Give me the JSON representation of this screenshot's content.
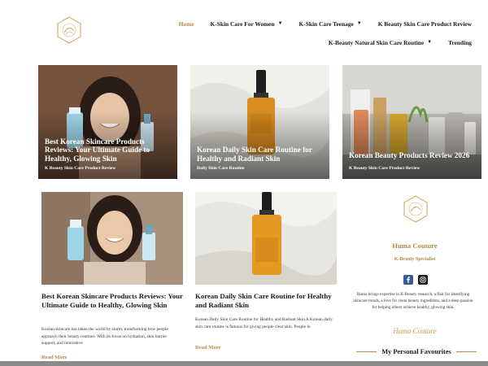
{
  "nav": {
    "row1": [
      {
        "label": "Home",
        "active": true,
        "dropdown": false
      },
      {
        "label": "K-Skin Care For Women",
        "active": false,
        "dropdown": true
      },
      {
        "label": "K-Skin Care Teenage",
        "active": false,
        "dropdown": true
      },
      {
        "label": "K Beauty Skin Care Product Review",
        "active": false,
        "dropdown": false
      }
    ],
    "row2": [
      {
        "label": "K-Beauty Natural Skin Care Routine",
        "active": false,
        "dropdown": true
      },
      {
        "label": "Trending",
        "active": false,
        "dropdown": false
      }
    ],
    "caret": "▼"
  },
  "hero": [
    {
      "title": "Best Korean Skincare Products Reviews: Your Ultimate Guide to Healthy, Glowing Skin",
      "category": "K Beauty Skin Care Product Review"
    },
    {
      "title": "Korean Daily Skin Care Routine for Healthy and Radiant Skin",
      "category": "Daily Skin Care Routine"
    },
    {
      "title": "Korean Beauty Products Review 2026",
      "category": "K Beauty Skin Care Product Review"
    }
  ],
  "cards": [
    {
      "title": "Best Korean Skincare Products Reviews: Your Ultimate Guide to Healthy, Glowing Skin",
      "excerpt": "Korean skincare has taken the world by storm, transforming how people approach their beauty routines. With its focus on hydration, skin barrier support, and innovative",
      "read_more": "Read More"
    },
    {
      "title": "Korean Daily Skin Care Routine for Healthy and Radiant Skin",
      "excerpt": "Korean Daily Skin Care Routine for Healthy and Radiant Skin A Korean daily skin care routine is famous for giving people clear skin. People in",
      "read_more": "Read More"
    }
  ],
  "sidebar": {
    "name": "Huma Couture",
    "role": "K-Beauty Specialist",
    "bio": "Huma brings expertise in K-Beauty research, a flair for identifying skincare trends, a love for clean beauty ingredients, and a deep passion for helping others achieve healthy, glowing skin.",
    "signature": "Huma Couture",
    "favourites_heading": "My Personal Favourites",
    "social": [
      {
        "icon": "facebook-icon",
        "color": "#3b5998"
      },
      {
        "icon": "instagram-icon",
        "color": "#1a1a1a"
      }
    ]
  },
  "colors": {
    "accent": "#b48a4a",
    "text": "#1a1a1a"
  }
}
